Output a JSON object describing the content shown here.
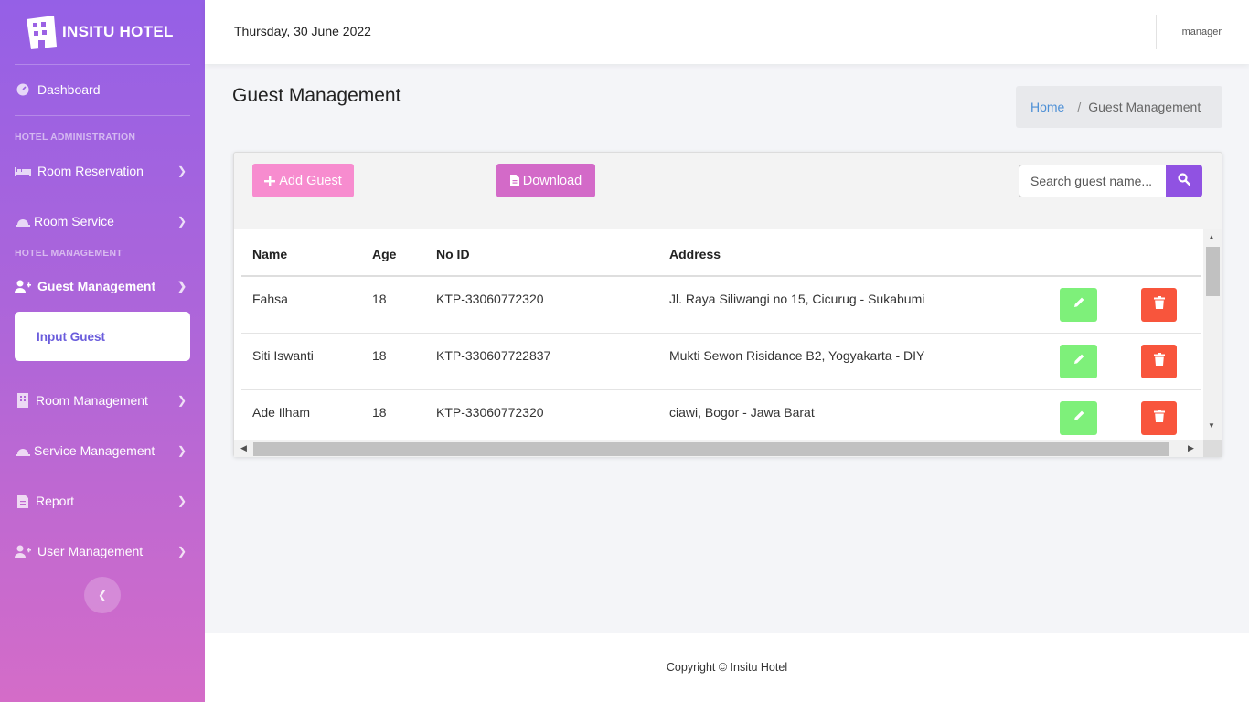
{
  "brand": {
    "name": "INSITU HOTEL",
    "icon": "hotel-icon"
  },
  "sidebar": {
    "dashboard": {
      "label": "Dashboard",
      "icon": "gauge-icon"
    },
    "sections": {
      "hotel_admin": "HOTEL ADMINISTRATION",
      "hotel_mgmt": "HOTEL MANAGEMENT"
    },
    "items": [
      {
        "label": "Room Reservation",
        "icon": "bed-icon"
      },
      {
        "label": "Room Service",
        "icon": "service-bell-icon"
      },
      {
        "label": "Guest Management",
        "icon": "user-plus-icon"
      },
      {
        "label": "Room Management",
        "icon": "building-icon"
      },
      {
        "label": "Service Management",
        "icon": "service-bell-icon"
      },
      {
        "label": "Report",
        "icon": "file-icon"
      },
      {
        "label": "User Management",
        "icon": "user-plus-icon"
      }
    ],
    "active_sub": "Input Guest"
  },
  "header": {
    "date": "Thursday, 30 June 2022",
    "user": "manager"
  },
  "page": {
    "title": "Guest Management",
    "breadcrumb": {
      "home": "Home",
      "sep": "/",
      "current": "Guest Management"
    }
  },
  "toolbar": {
    "add_label": "Add Guest",
    "download_label": "Download",
    "search_placeholder": "Search guest name..."
  },
  "table": {
    "columns": [
      "Name",
      "Age",
      "No ID",
      "Address"
    ],
    "rows": [
      {
        "name": "Fahsa",
        "age": "18",
        "id": "KTP-33060772320",
        "address": "Jl. Raya Siliwangi no 15, Cicurug - Sukabumi"
      },
      {
        "name": "Siti Iswanti",
        "age": "18",
        "id": "KTP-330607722837",
        "address": "Mukti Sewon Risidance B2, Yogyakarta - DIY"
      },
      {
        "name": "Ade Ilham",
        "age": "18",
        "id": "KTP-33060772320",
        "address": "ciawi, Bogor - Jawa Barat"
      }
    ]
  },
  "colors": {
    "accent": "#9052e2",
    "add": "#f78ccf",
    "download": "#d36ac8",
    "edit": "#7ef07a",
    "delete": "#f8553c"
  },
  "footer": {
    "copyright": "Copyright © Insitu Hotel"
  }
}
